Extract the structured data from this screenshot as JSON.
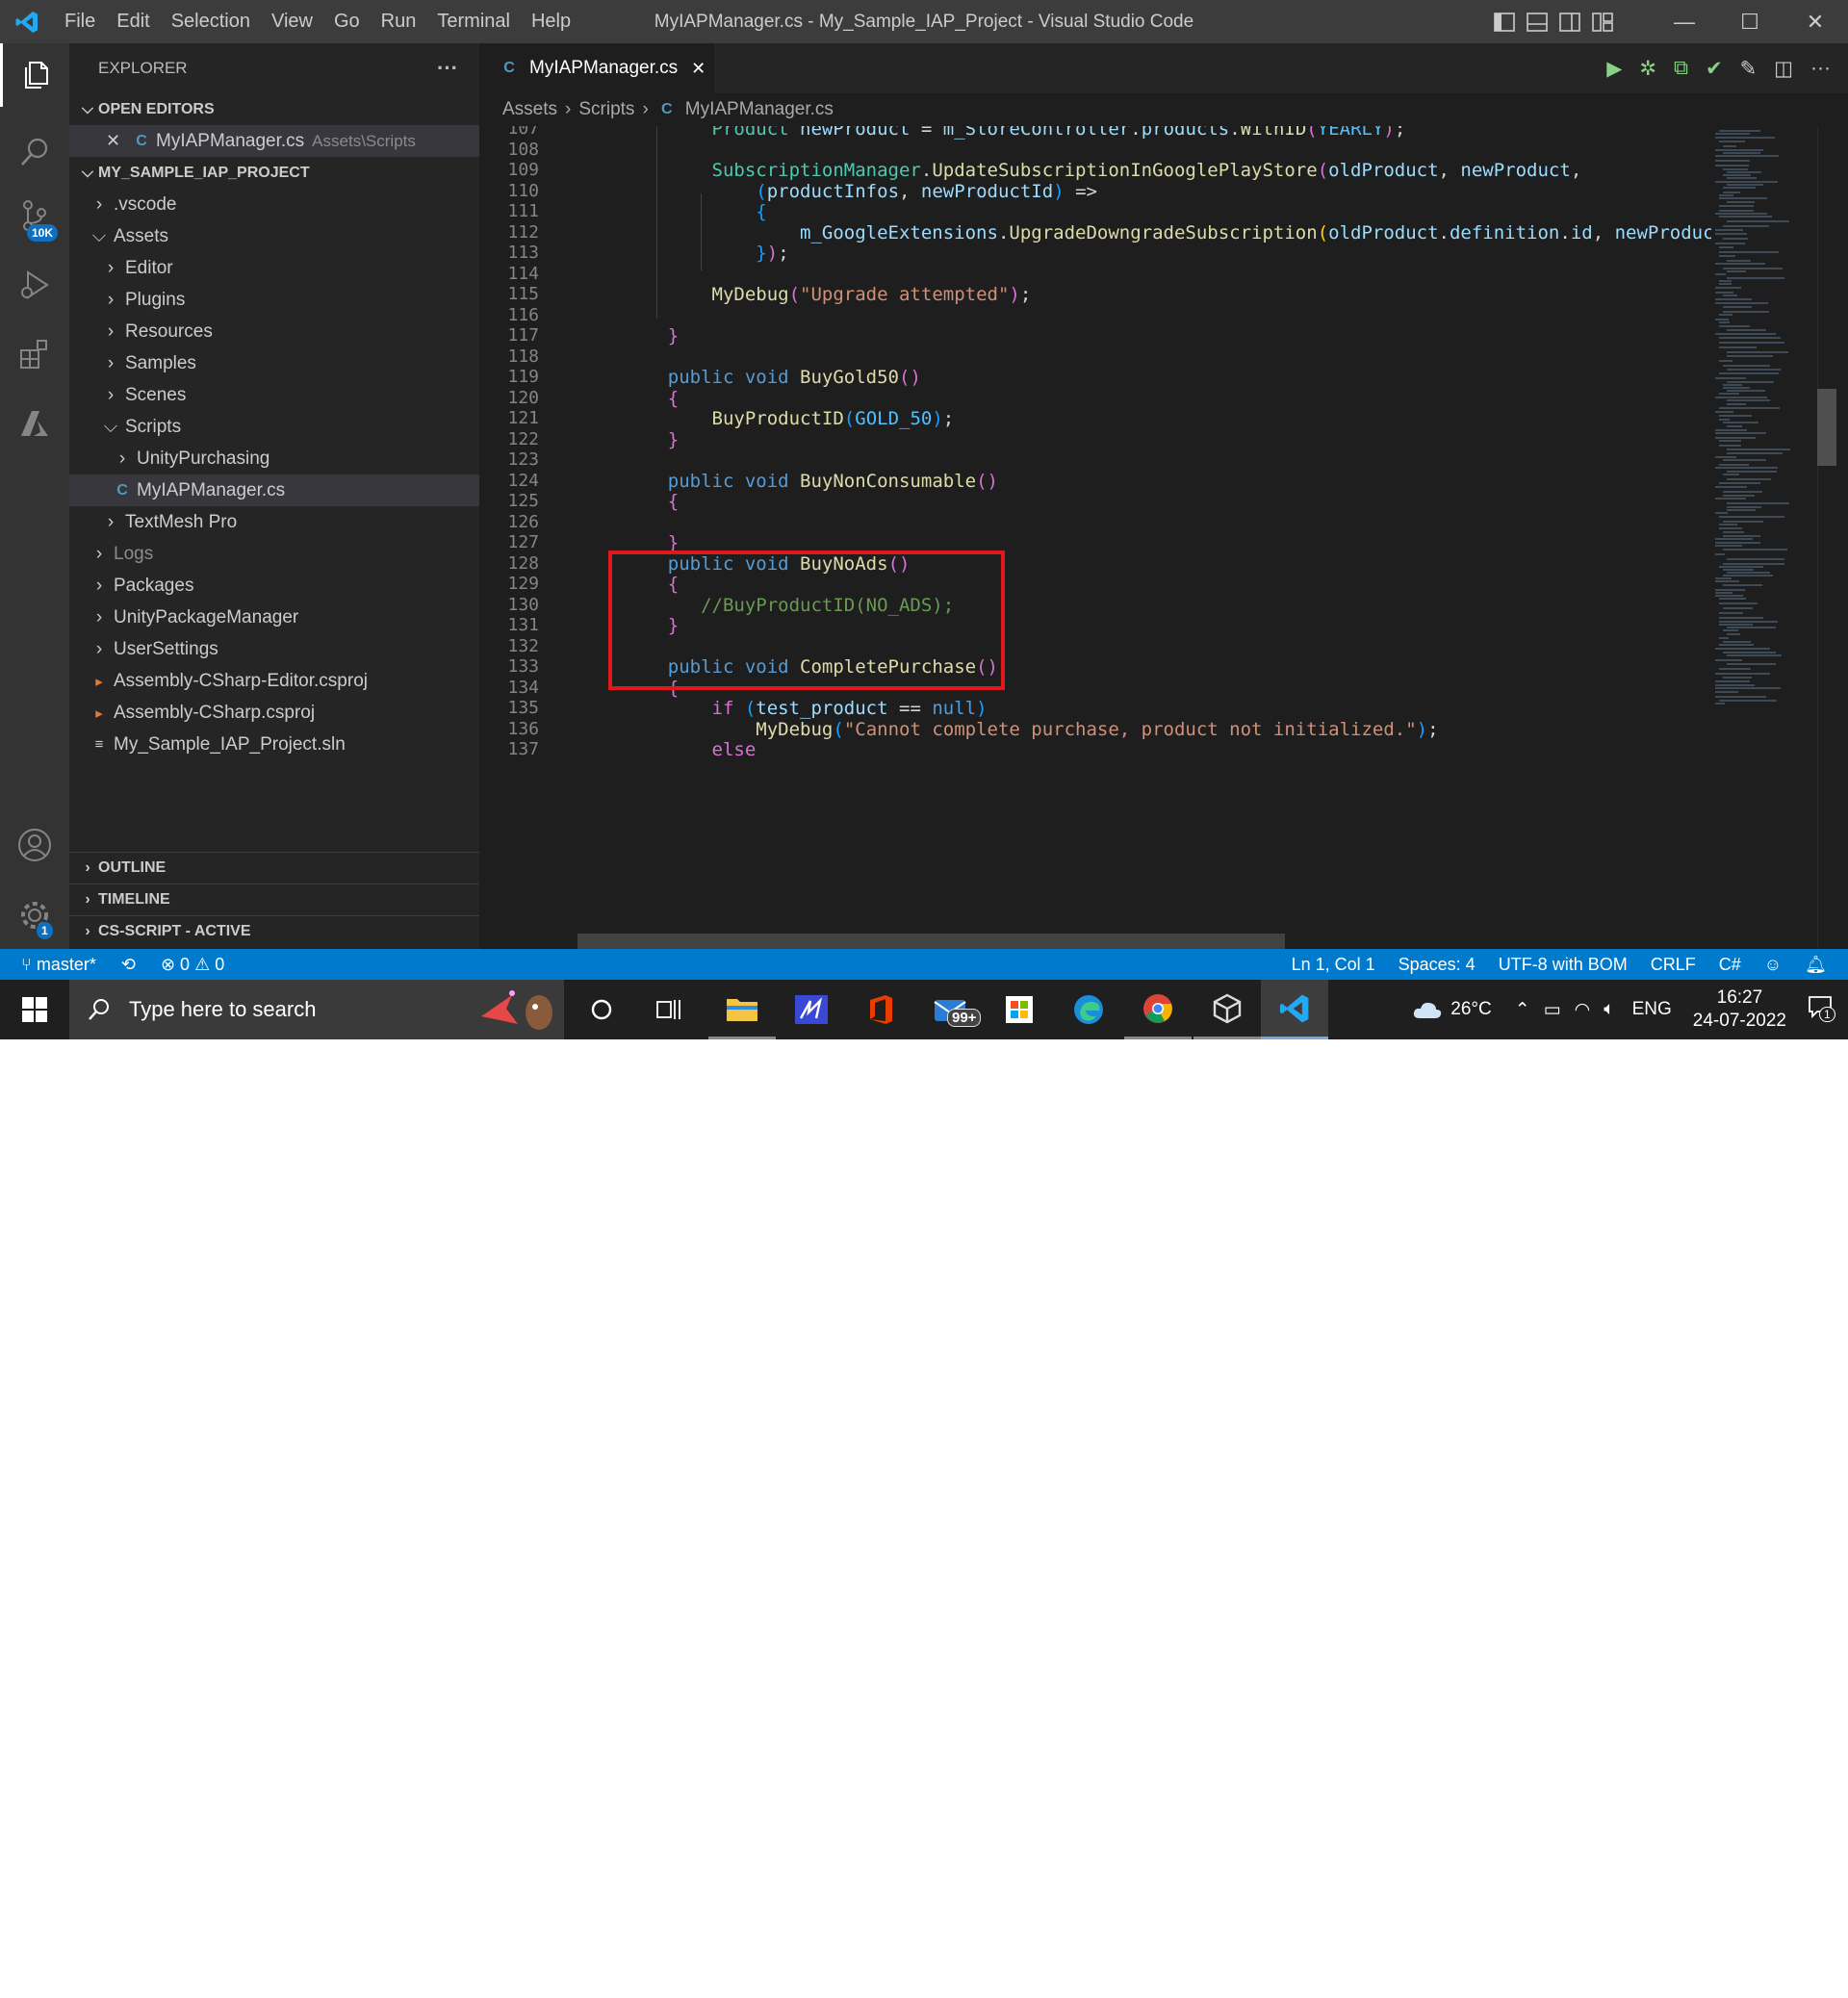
{
  "window": {
    "title": "MyIAPManager.cs - My_Sample_IAP_Project - Visual Studio Code",
    "menu": [
      "File",
      "Edit",
      "Selection",
      "View",
      "Go",
      "Run",
      "Terminal",
      "Help"
    ],
    "controls": {
      "minimize": "—",
      "maximize": "☐",
      "close": "✕"
    }
  },
  "activity_bar": {
    "source_control_badge": "10K",
    "settings_badge": "1"
  },
  "sidebar": {
    "title": "EXPLORER",
    "more": "···",
    "open_editors": {
      "label": "OPEN EDITORS",
      "file": "MyIAPManager.cs",
      "path": "Assets\\Scripts"
    },
    "project": {
      "label": "MY_SAMPLE_IAP_PROJECT",
      "items": [
        {
          "label": ".vscode",
          "depth": 1,
          "kind": "folder-closed"
        },
        {
          "label": "Assets",
          "depth": 1,
          "kind": "folder-open"
        },
        {
          "label": "Editor",
          "depth": 2,
          "kind": "folder-closed"
        },
        {
          "label": "Plugins",
          "depth": 2,
          "kind": "folder-closed"
        },
        {
          "label": "Resources",
          "depth": 2,
          "kind": "folder-closed"
        },
        {
          "label": "Samples",
          "depth": 2,
          "kind": "folder-closed"
        },
        {
          "label": "Scenes",
          "depth": 2,
          "kind": "folder-closed"
        },
        {
          "label": "Scripts",
          "depth": 2,
          "kind": "folder-open"
        },
        {
          "label": "UnityPurchasing",
          "depth": 3,
          "kind": "folder-closed"
        },
        {
          "label": "MyIAPManager.cs",
          "depth": 3,
          "kind": "cs-file",
          "selected": true
        },
        {
          "label": "TextMesh Pro",
          "depth": 2,
          "kind": "folder-closed"
        },
        {
          "label": "Logs",
          "depth": 1,
          "kind": "folder-closed",
          "dimmed": true
        },
        {
          "label": "Packages",
          "depth": 1,
          "kind": "folder-closed"
        },
        {
          "label": "UnityPackageManager",
          "depth": 1,
          "kind": "folder-closed"
        },
        {
          "label": "UserSettings",
          "depth": 1,
          "kind": "folder-closed"
        },
        {
          "label": "Assembly-CSharp-Editor.csproj",
          "depth": 1,
          "kind": "rss-file"
        },
        {
          "label": "Assembly-CSharp.csproj",
          "depth": 1,
          "kind": "rss-file"
        },
        {
          "label": "My_Sample_IAP_Project.sln",
          "depth": 1,
          "kind": "sln-file"
        }
      ]
    },
    "bottom_sections": [
      "OUTLINE",
      "TIMELINE",
      "CS-SCRIPT - ACTIVE"
    ]
  },
  "tab": {
    "label": "MyIAPManager.cs",
    "close": "✕"
  },
  "breadcrumb": [
    "Assets",
    "Scripts",
    "MyIAPManager.cs"
  ],
  "editor": {
    "first_line": 107,
    "lines": [
      [
        [
          "        ",
          ""
        ],
        [
          "Product ",
          "ty"
        ],
        [
          "newProduct ",
          "pm"
        ],
        [
          "= ",
          ""
        ],
        [
          "m_StoreController",
          "pm"
        ],
        [
          ".",
          ""
        ],
        [
          "products",
          "pm"
        ],
        [
          ".",
          ""
        ],
        [
          "WithID",
          "fn"
        ],
        [
          "(",
          "b2"
        ],
        [
          "YEARLY",
          "ct"
        ],
        [
          ")",
          "b2"
        ],
        [
          ";",
          ""
        ]
      ],
      [],
      [
        [
          "        ",
          ""
        ],
        [
          "SubscriptionManager",
          "ty"
        ],
        [
          ".",
          ""
        ],
        [
          "UpdateSubscriptionInGooglePlayStore",
          "fn"
        ],
        [
          "(",
          "b2"
        ],
        [
          "oldProduct",
          "pm"
        ],
        [
          ", ",
          ""
        ],
        [
          "newProduct",
          "pm"
        ],
        [
          ",",
          ""
        ]
      ],
      [
        [
          "            ",
          ""
        ],
        [
          "(",
          "b3"
        ],
        [
          "productInfos",
          "pm"
        ],
        [
          ", ",
          ""
        ],
        [
          "newProductId",
          "pm"
        ],
        [
          ")",
          "b3"
        ],
        [
          " =>",
          ""
        ]
      ],
      [
        [
          "            ",
          ""
        ],
        [
          "{",
          "b3"
        ]
      ],
      [
        [
          "                ",
          ""
        ],
        [
          "m_GoogleExtensions",
          "pm"
        ],
        [
          ".",
          ""
        ],
        [
          "UpgradeDowngradeSubscription",
          "fn"
        ],
        [
          "(",
          "b1"
        ],
        [
          "oldProduct",
          "pm"
        ],
        [
          ".",
          ""
        ],
        [
          "definition",
          "pm"
        ],
        [
          ".",
          ""
        ],
        [
          "id",
          "pm"
        ],
        [
          ", ",
          ""
        ],
        [
          "newProduct",
          "pm"
        ],
        [
          ".c",
          ""
        ]
      ],
      [
        [
          "            ",
          ""
        ],
        [
          "}",
          "b3"
        ],
        [
          ")",
          "b2"
        ],
        [
          ";",
          ""
        ]
      ],
      [],
      [
        [
          "        ",
          ""
        ],
        [
          "MyDebug",
          "fn"
        ],
        [
          "(",
          "b2"
        ],
        [
          "\"Upgrade attempted\"",
          "st"
        ],
        [
          ")",
          "b2"
        ],
        [
          ";",
          ""
        ]
      ],
      [],
      [
        [
          "    ",
          ""
        ],
        [
          "}",
          "b2"
        ]
      ],
      [],
      [
        [
          "    ",
          ""
        ],
        [
          "public ",
          "kw"
        ],
        [
          "void ",
          "kw"
        ],
        [
          "BuyGold50",
          "fn"
        ],
        [
          "()",
          "b2"
        ]
      ],
      [
        [
          "    ",
          ""
        ],
        [
          "{",
          "b2"
        ]
      ],
      [
        [
          "        ",
          ""
        ],
        [
          "BuyProductID",
          "fn"
        ],
        [
          "(",
          "b3"
        ],
        [
          "GOLD_50",
          "ct"
        ],
        [
          ")",
          "b3"
        ],
        [
          ";",
          ""
        ]
      ],
      [
        [
          "    ",
          ""
        ],
        [
          "}",
          "b2"
        ]
      ],
      [],
      [
        [
          "    ",
          ""
        ],
        [
          "public ",
          "kw"
        ],
        [
          "void ",
          "kw"
        ],
        [
          "BuyNonConsumable",
          "fn"
        ],
        [
          "()",
          "b2"
        ]
      ],
      [
        [
          "    ",
          ""
        ],
        [
          "{",
          "b2"
        ]
      ],
      [],
      [
        [
          "    ",
          ""
        ],
        [
          "}",
          "b2"
        ]
      ],
      [
        [
          "    ",
          ""
        ],
        [
          "public ",
          "kw"
        ],
        [
          "void ",
          "kw"
        ],
        [
          "BuyNoAds",
          "fn"
        ],
        [
          "()",
          "b2"
        ]
      ],
      [
        [
          "    ",
          ""
        ],
        [
          "{",
          "b2"
        ]
      ],
      [
        [
          "       ",
          ""
        ],
        [
          "//BuyProductID(NO_ADS);",
          "cm"
        ]
      ],
      [
        [
          "    ",
          ""
        ],
        [
          "}",
          "b2"
        ]
      ],
      [],
      [
        [
          "    ",
          ""
        ],
        [
          "public ",
          "kw"
        ],
        [
          "void ",
          "kw"
        ],
        [
          "CompletePurchase",
          "fn"
        ],
        [
          "()",
          "b2"
        ]
      ],
      [
        [
          "    ",
          ""
        ],
        [
          "{",
          "b2"
        ]
      ],
      [
        [
          "        ",
          ""
        ],
        [
          "if ",
          "b2"
        ],
        [
          "(",
          "b3"
        ],
        [
          "test_product ",
          "pm"
        ],
        [
          "== ",
          ""
        ],
        [
          "null",
          "nl"
        ],
        [
          ")",
          "b3"
        ]
      ],
      [
        [
          "            ",
          ""
        ],
        [
          "MyDebug",
          "fn"
        ],
        [
          "(",
          "b3"
        ],
        [
          "\"Cannot complete purchase, product not initialized.\"",
          "st"
        ],
        [
          ")",
          "b3"
        ],
        [
          ";",
          ""
        ]
      ],
      [
        [
          "        ",
          ""
        ],
        [
          "else",
          "b2"
        ]
      ]
    ]
  },
  "status_bar": {
    "branch": "master*",
    "errors": "0",
    "warnings": "0",
    "position": "Ln 1, Col 1",
    "spaces": "Spaces: 4",
    "encoding": "UTF-8 with BOM",
    "eol": "CRLF",
    "language": "C#"
  },
  "taskbar": {
    "search_placeholder": "Type here to search",
    "mail_badge": "99+",
    "weather": "26°C",
    "language": "ENG",
    "time": "16:27",
    "date": "24-07-2022",
    "notifications": "1"
  },
  "colors": {
    "accent": "#007acc",
    "highlight_box": "#e0181b"
  }
}
